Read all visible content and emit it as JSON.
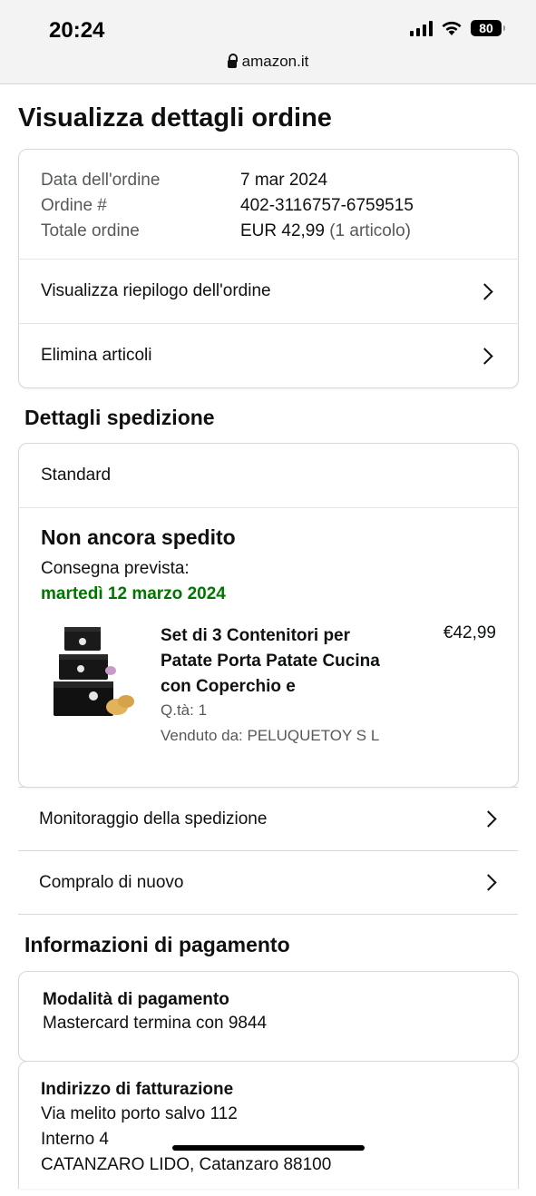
{
  "status_bar": {
    "time": "20:24",
    "battery": "80"
  },
  "url_bar": {
    "domain": "amazon.it"
  },
  "page": {
    "title": "Visualizza dettagli ordine"
  },
  "order_summary": {
    "date_label": "Data dell'ordine",
    "date_value": "7 mar 2024",
    "number_label": "Ordine #",
    "number_value": "402-3116757-6759515",
    "total_label": "Totale ordine",
    "total_value": "EUR 42,99",
    "total_items": "(1 articolo)",
    "links": [
      "Visualizza riepilogo dell'ordine",
      "Elimina articoli"
    ]
  },
  "shipping": {
    "section_title": "Dettagli spedizione",
    "method": "Standard",
    "status": "Non ancora spedito",
    "delivery_label": "Consegna prevista:",
    "delivery_date": "martedì 12 marzo 2024",
    "item": {
      "title": "Set di 3 Contenitori per Patate Porta Patate Cucina con Coperchio e",
      "price": "€42,99",
      "quantity": "Q.tà: 1",
      "seller": "Venduto da: PELUQUETOY S L"
    },
    "actions": [
      "Monitoraggio della spedizione",
      "Compralo di nuovo"
    ]
  },
  "payment": {
    "section_title": "Informazioni di pagamento",
    "method_title": "Modalità di pagamento",
    "method_value": "Mastercard termina con 9844",
    "billing_title": "Indirizzo di fatturazione",
    "billing_lines": [
      "Via melito porto salvo 112",
      "Interno 4",
      "CATANZARO LIDO, Catanzaro 88100"
    ]
  },
  "colors": {
    "delivery_green": "#007600",
    "text": "#0f1111",
    "muted": "#565959"
  },
  "icons": [
    "lock-icon",
    "chevron-right-icon",
    "cellular-signal-icon",
    "wifi-icon",
    "battery-icon"
  ]
}
